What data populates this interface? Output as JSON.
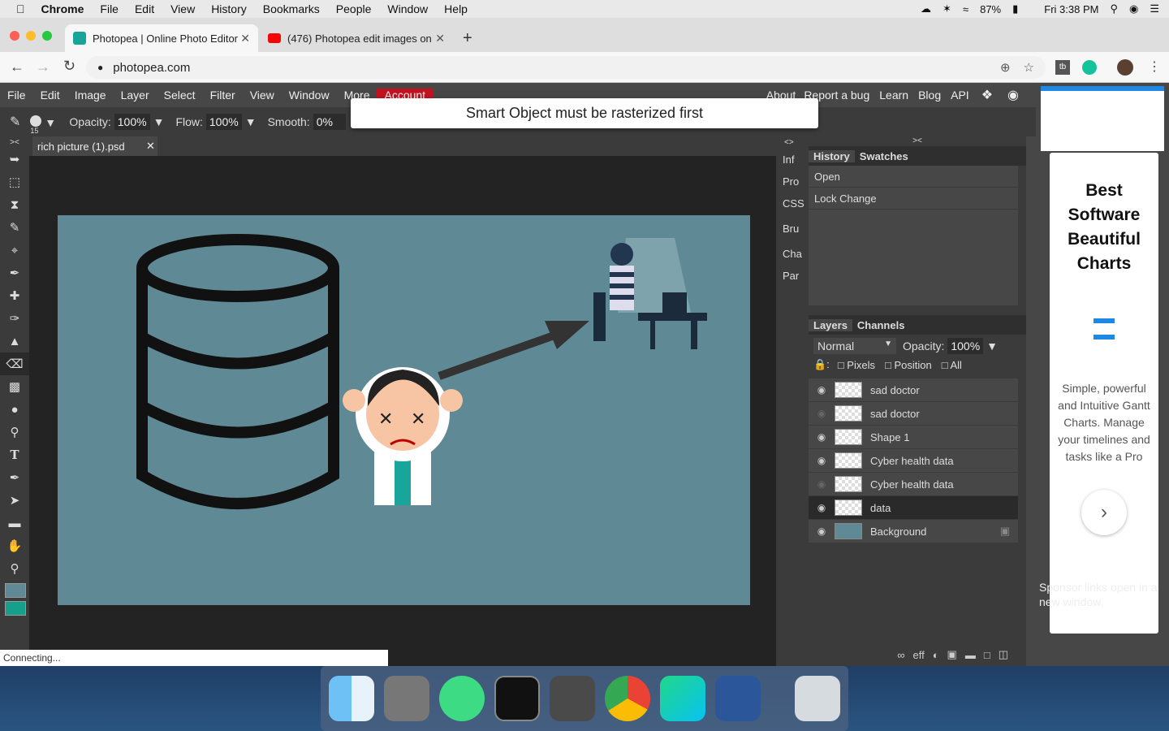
{
  "mac_menu": {
    "app": "Chrome",
    "items": [
      "File",
      "Edit",
      "View",
      "History",
      "Bookmarks",
      "People",
      "Window",
      "Help"
    ],
    "battery": "87%",
    "clock": "Fri 3:38 PM"
  },
  "browser": {
    "tabs": [
      {
        "title": "Photopea | Online Photo Editor",
        "active": true
      },
      {
        "title": "(476) Photopea edit images on",
        "active": false
      }
    ],
    "url": "photopea.com"
  },
  "photopea": {
    "menu": [
      "File",
      "Edit",
      "Image",
      "Layer",
      "Select",
      "Filter",
      "View",
      "Window",
      "More",
      "Account"
    ],
    "menu_right": [
      "About",
      "Report a bug",
      "Learn",
      "Blog",
      "API"
    ],
    "options": {
      "opacity_label": "Opacity:",
      "opacity": "100%",
      "flow_label": "Flow:",
      "flow": "100%",
      "smooth_label": "Smooth:",
      "smooth": "0%",
      "brush_size": "15"
    },
    "toast": "Smart Object must be rasterized first",
    "document_tab": "rich picture (1).psd",
    "side_tabs": [
      "Inf",
      "Pro",
      "CSS",
      "Bru",
      "Cha",
      "Par"
    ],
    "history_tabs": [
      "History",
      "Swatches"
    ],
    "history_items": [
      "Open",
      "Lock Change"
    ],
    "layers_tabs": [
      "Layers",
      "Channels"
    ],
    "blend_mode": "Normal",
    "layer_opacity_label": "Opacity:",
    "layer_opacity": "100%",
    "lock_options": [
      "Pixels",
      "Position",
      "All"
    ],
    "layers": [
      {
        "name": "sad doctor",
        "visible": true,
        "selected": false
      },
      {
        "name": "sad doctor",
        "visible": false,
        "selected": false
      },
      {
        "name": "Shape 1",
        "visible": true,
        "selected": false
      },
      {
        "name": "Cyber health data",
        "visible": true,
        "selected": false
      },
      {
        "name": "Cyber health data",
        "visible": false,
        "selected": false
      },
      {
        "name": "data",
        "visible": true,
        "selected": true
      },
      {
        "name": "Background",
        "visible": true,
        "selected": false,
        "locked": true
      }
    ],
    "colors": {
      "canvas": "#5f8a95",
      "foreground": "#5f8a95",
      "background": "#14a08c"
    }
  },
  "ad": {
    "headline": "Best Software Beautiful Charts",
    "body": "Simple, powerful and Intuitive Gantt Charts. Manage your timelines and tasks like a Pro",
    "footer": "Sponsor links open in a new window."
  },
  "status": "Connecting..."
}
